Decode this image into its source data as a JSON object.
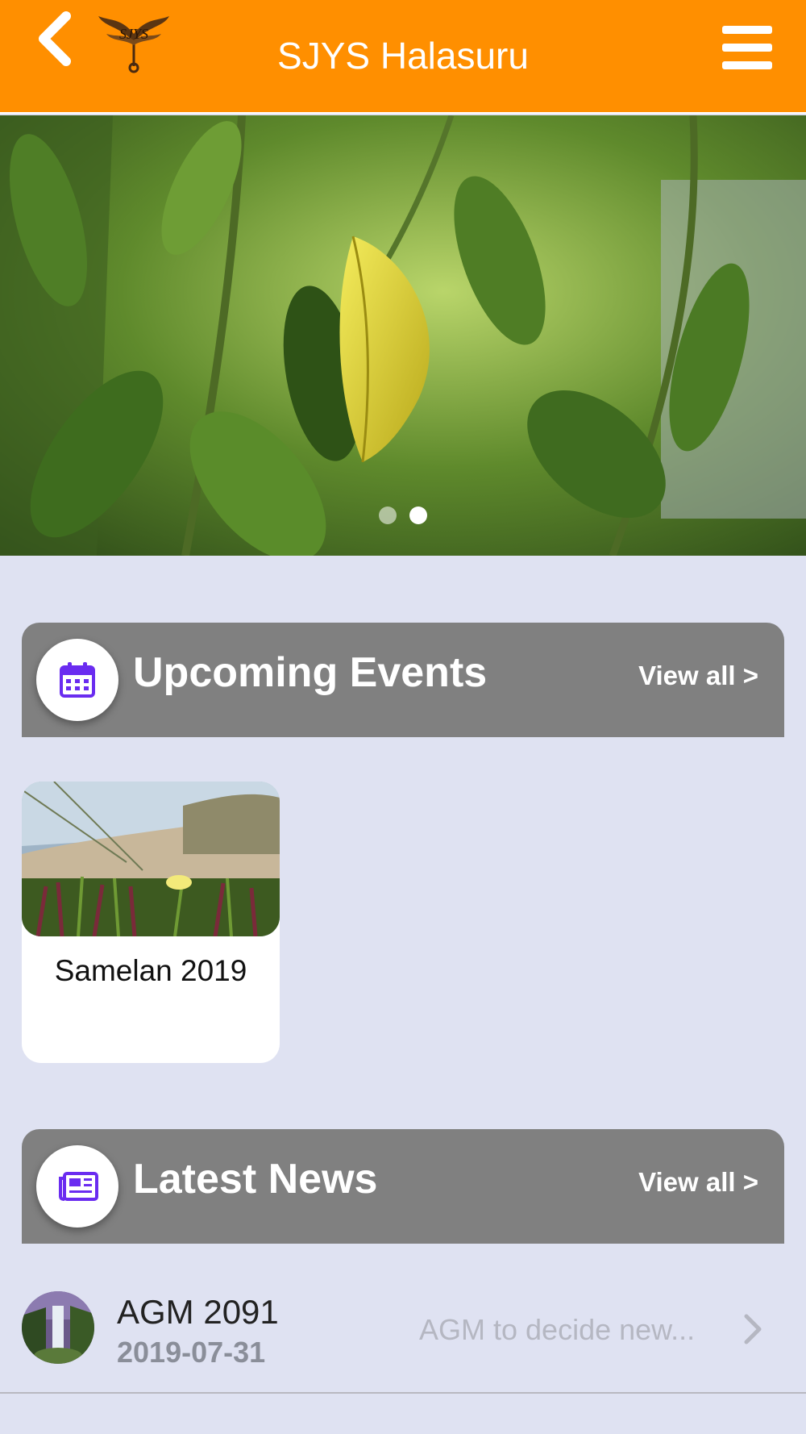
{
  "header": {
    "title": "SJYS Halasuru",
    "logo_text": "SJYS",
    "accent_color": "#ff8f00"
  },
  "hero": {
    "slide_count": 2,
    "active_slide": 2
  },
  "events": {
    "title": "Upcoming Events",
    "view_all": "View all >",
    "icon": "calendar-icon",
    "items": [
      {
        "label": "Samelan 2019"
      }
    ]
  },
  "news": {
    "title": "Latest News",
    "view_all": "View all >",
    "icon": "newspaper-icon",
    "items": [
      {
        "title": "AGM 2091",
        "date": "2019-07-31",
        "summary": "AGM to decide new..."
      }
    ]
  },
  "colors": {
    "section_bar": "#808080",
    "background": "#dfe2f2",
    "icon_purple": "#6a2cf0"
  }
}
